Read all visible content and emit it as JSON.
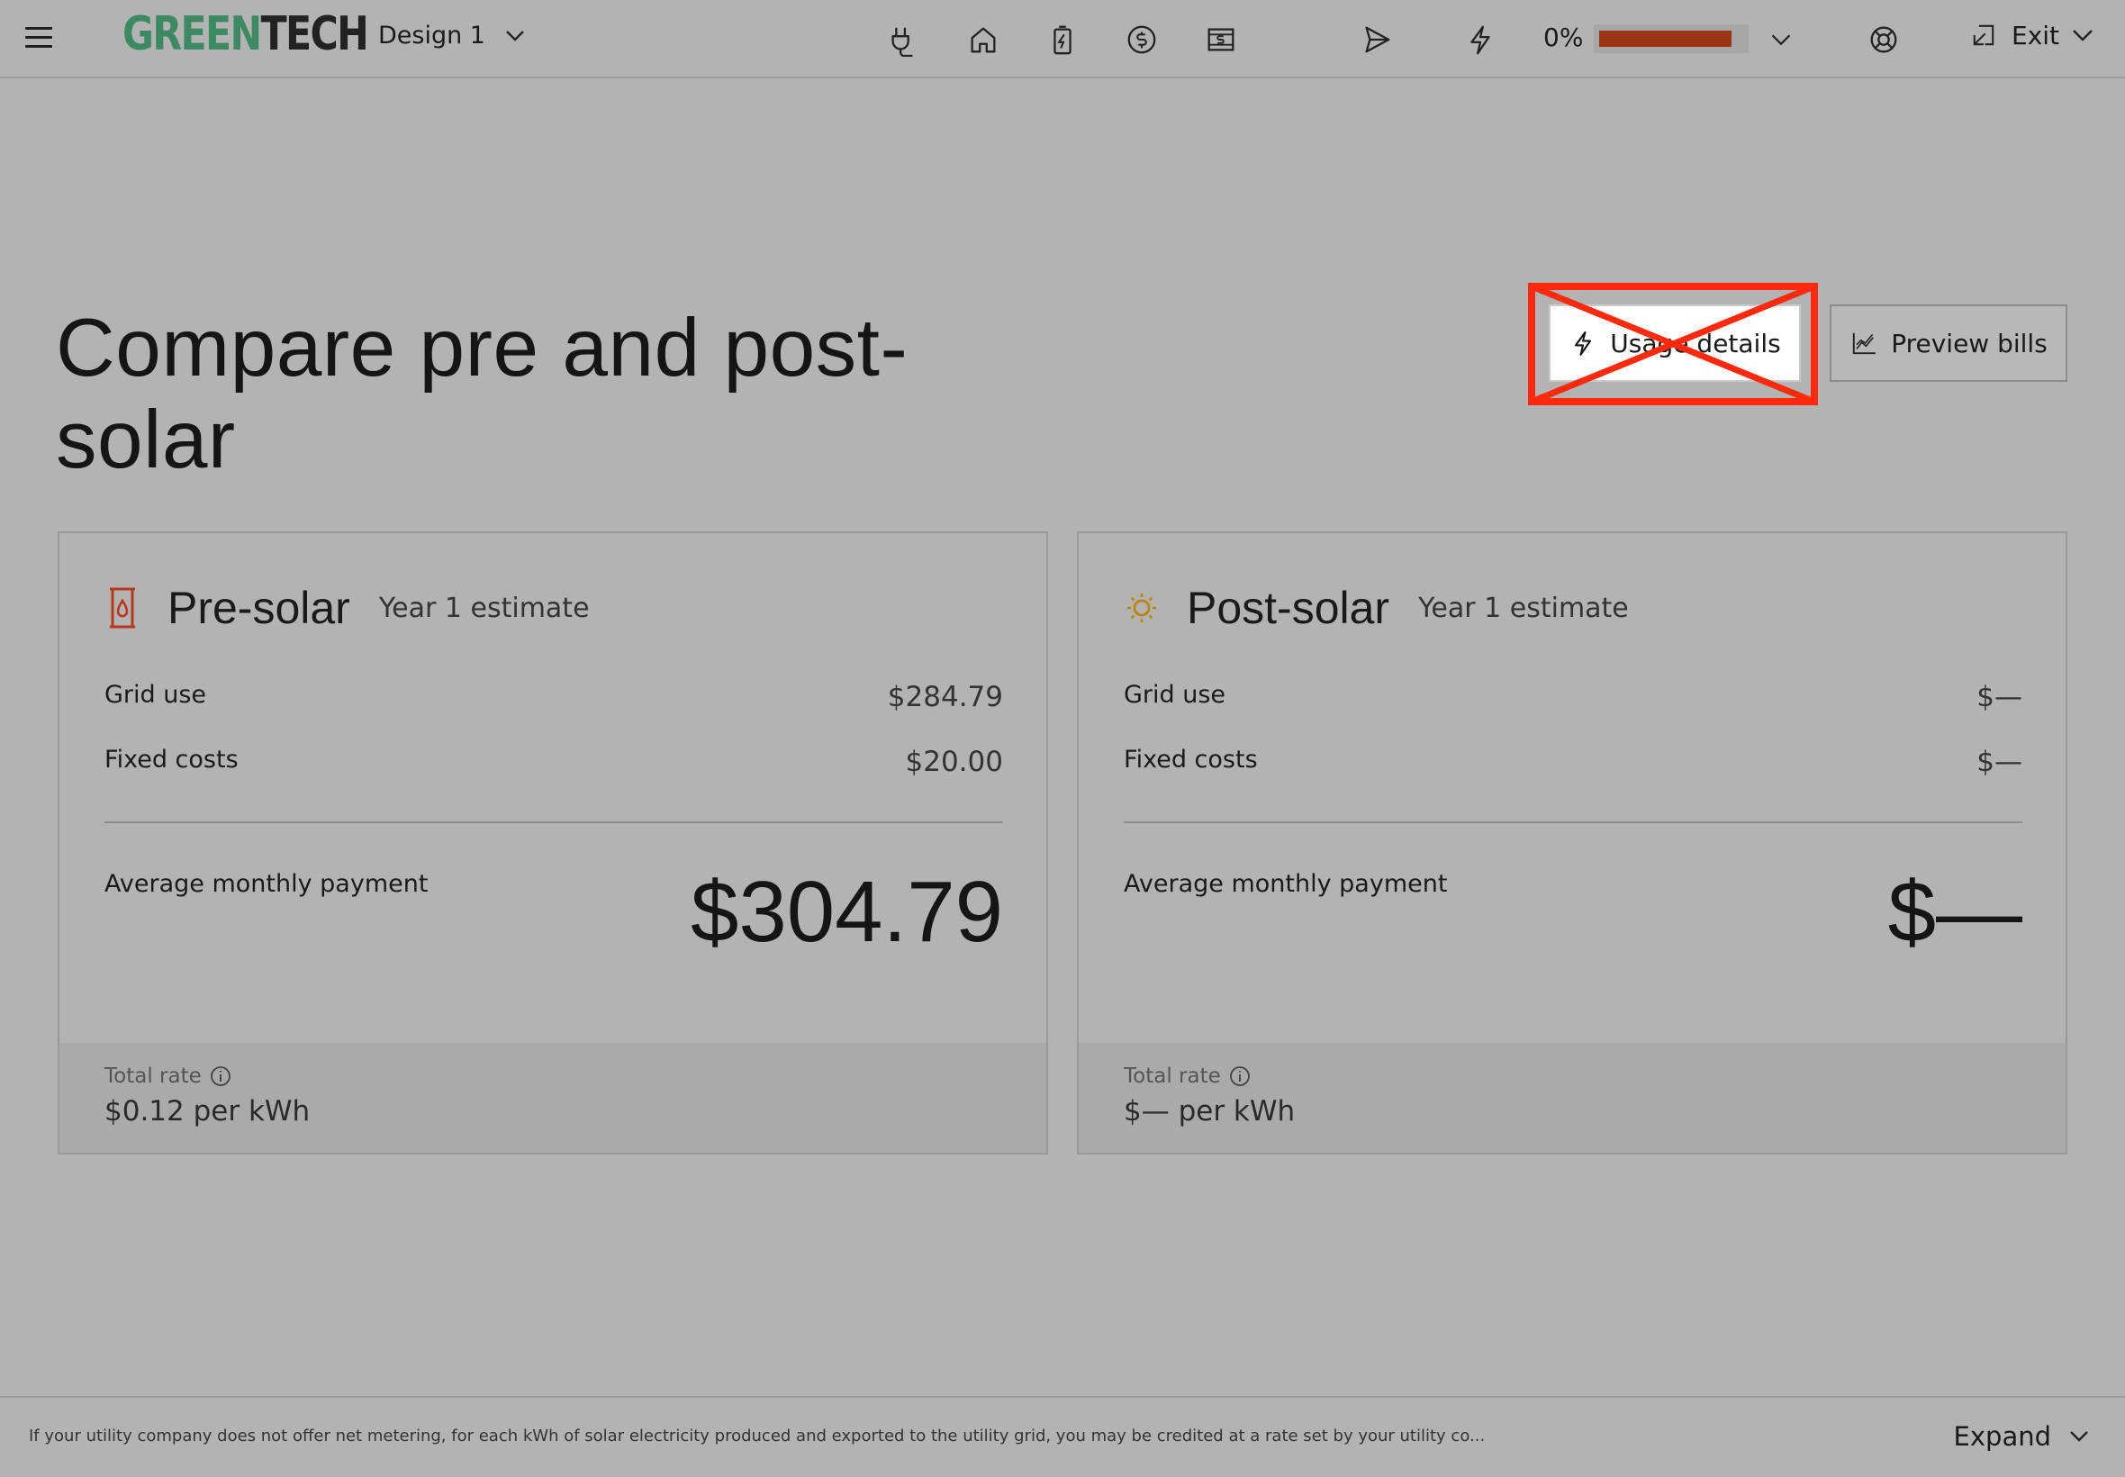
{
  "header": {
    "logo_green": "GREEN",
    "logo_dark": "TECH",
    "design_select": "Design 1",
    "progress_label": "0%",
    "progress_value": 0.92,
    "exit_label": "Exit",
    "icons": [
      "menu-icon",
      "plug-icon",
      "home-icon",
      "battery-icon",
      "dollar-circle-icon",
      "cash-icon",
      "send-icon",
      "bolt-icon",
      "lifebuoy-icon",
      "exit-icon"
    ]
  },
  "main": {
    "title": "Compare pre and post-solar",
    "usage_button": "Usage details",
    "preview_button": "Preview bills"
  },
  "cards": {
    "pre": {
      "title": "Pre-solar",
      "subtitle": "Year 1 estimate",
      "grid_use_label": "Grid use",
      "grid_use_value": "$284.79",
      "fixed_label": "Fixed costs",
      "fixed_value": "$20.00",
      "avg_label": "Average monthly payment",
      "avg_value": "$304.79",
      "rate_label": "Total rate",
      "rate_value": "$0.12 per kWh",
      "icon_color": "#b5391a"
    },
    "post": {
      "title": "Post-solar",
      "subtitle": "Year 1 estimate",
      "grid_use_label": "Grid use",
      "grid_use_value": "$—",
      "fixed_label": "Fixed costs",
      "fixed_value": "$—",
      "avg_label": "Average monthly payment",
      "avg_value": "$—",
      "rate_label": "Total rate",
      "rate_value": "$— per kWh",
      "icon_color": "#b8860b"
    }
  },
  "footer": {
    "disclaimer": "If your utility company does not offer net metering, for each kWh of solar electricity produced and exported to the utility grid, you may be credited at a rate set by your utility co...",
    "expand_label": "Expand"
  },
  "colors": {
    "brand_green": "#3d8a62",
    "progress_fill": "#9a3412",
    "annotation_red": "#ff2a0d"
  }
}
